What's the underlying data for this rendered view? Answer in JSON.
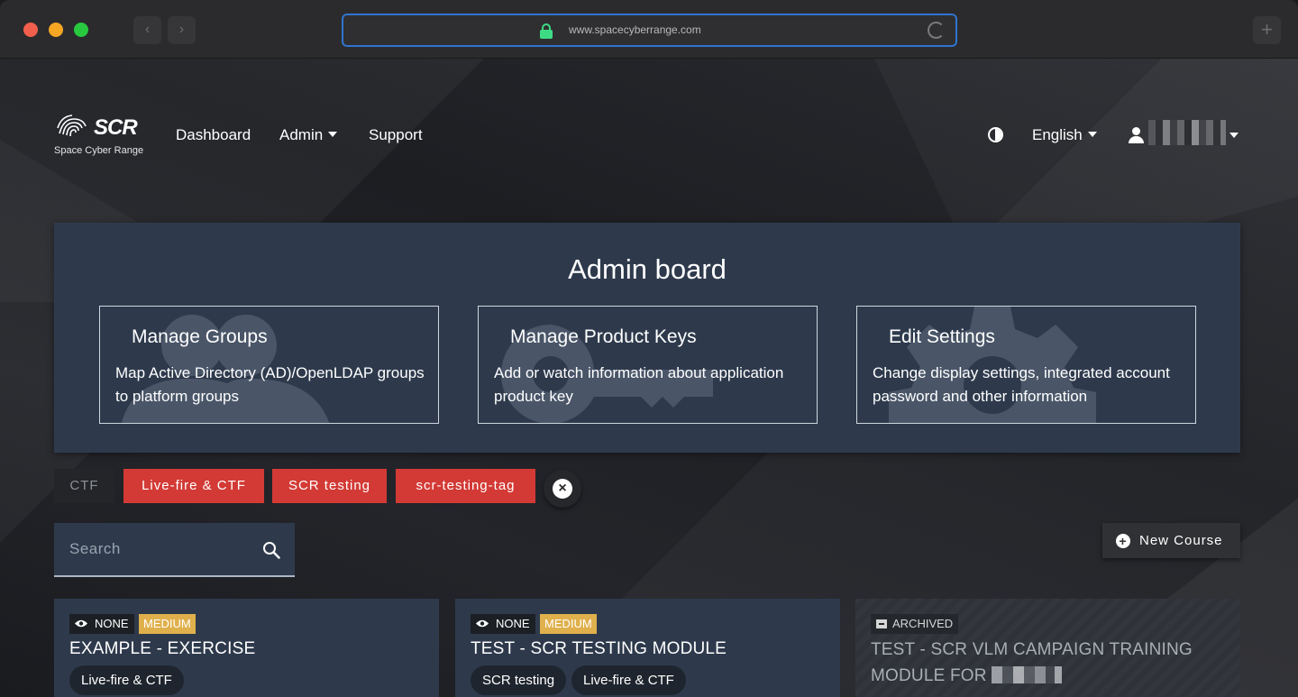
{
  "browser": {
    "url": "www.spacecyberrange.com",
    "back_icon": "chevron-left-icon",
    "forward_icon": "chevron-right-icon",
    "new_tab_label": "+"
  },
  "header": {
    "logo_text": "SCR",
    "logo_subtitle": "Space Cyber Range",
    "nav": {
      "dashboard": "Dashboard",
      "admin": "Admin",
      "support": "Support"
    },
    "language": "English"
  },
  "admin_board": {
    "title": "Admin board",
    "cards": [
      {
        "title": "Manage Groups",
        "description": "Map Active Directory (AD)/OpenLDAP groups to platform groups",
        "icon": "users-icon"
      },
      {
        "title": "Manage Product Keys",
        "description": "Add or watch information about application product key",
        "icon": "key-icon"
      },
      {
        "title": "Edit Settings",
        "description": "Change display settings, integrated account password and other information",
        "icon": "gear-icon"
      }
    ]
  },
  "tags": [
    "CTF",
    "Live-fire & CTF",
    "SCR testing",
    "scr-testing-tag"
  ],
  "colors": {
    "accent_red": "#d33a35",
    "panel": "#2e3a4c",
    "badge_medium": "#e0b04c"
  },
  "search": {
    "placeholder": "Search"
  },
  "new_course_label": "New Course",
  "courses": [
    {
      "visibility": "NONE",
      "difficulty": "MEDIUM",
      "title": "EXAMPLE - EXERCISE",
      "tags": [
        "Live-fire & CTF"
      ]
    },
    {
      "visibility": "NONE",
      "difficulty": "MEDIUM",
      "title": "TEST - SCR TESTING MODULE",
      "tags": [
        "SCR testing",
        "Live-fire & CTF"
      ]
    },
    {
      "status": "ARCHIVED",
      "title": "TEST - SCR VLM CAMPAIGN TRAINING MODULE FOR"
    }
  ]
}
